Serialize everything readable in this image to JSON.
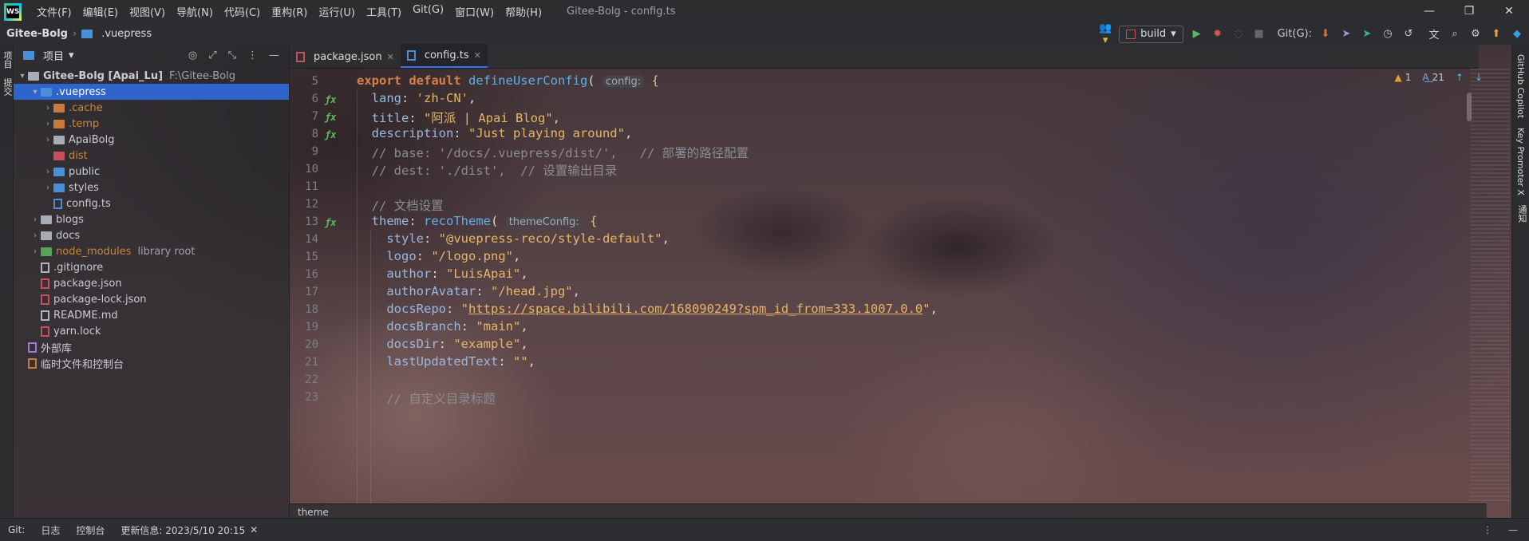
{
  "window": {
    "logo_text": "WS",
    "menu": [
      "文件(F)",
      "编辑(E)",
      "视图(V)",
      "导航(N)",
      "代码(C)",
      "重构(R)",
      "运行(U)",
      "工具(T)",
      "Git(G)",
      "窗口(W)",
      "帮助(H)"
    ],
    "title": "Gitee-Bolg - config.ts",
    "controls": [
      "—",
      "❐",
      "✕"
    ]
  },
  "nav": {
    "project": "Gitee-Bolg",
    "sep": "›",
    "folder": ".vuepress",
    "run_config": "build",
    "git_label": "Git(G):"
  },
  "left_strip": {
    "tabs": [
      "项目",
      "提交"
    ]
  },
  "project_panel": {
    "header": "项目",
    "tree": [
      {
        "label": "Gitee-Bolg [Apai_Lu]",
        "extra": "F:\\Gitee-Bolg",
        "depth": 0,
        "arrow": "▾",
        "icon": "folder",
        "color": "gray",
        "bold": true
      },
      {
        "label": ".vuepress",
        "depth": 1,
        "arrow": "▾",
        "icon": "folder",
        "color": "blue",
        "selected": true
      },
      {
        "label": ".cache",
        "depth": 2,
        "arrow": "›",
        "icon": "folder",
        "color": "orange",
        "dim": true
      },
      {
        "label": ".temp",
        "depth": 2,
        "arrow": "›",
        "icon": "folder",
        "color": "orange",
        "dim": true
      },
      {
        "label": "ApaiBolg",
        "depth": 2,
        "arrow": "›",
        "icon": "folder",
        "color": "gray"
      },
      {
        "label": "dist",
        "depth": 2,
        "arrow": "",
        "icon": "folder",
        "color": "red",
        "dim": true
      },
      {
        "label": "public",
        "depth": 2,
        "arrow": "›",
        "icon": "folder",
        "color": "blue"
      },
      {
        "label": "styles",
        "depth": 2,
        "arrow": "›",
        "icon": "folder",
        "color": "blue"
      },
      {
        "label": "config.ts",
        "depth": 2,
        "arrow": "",
        "icon": "ts",
        "color": "blue"
      },
      {
        "label": "blogs",
        "depth": 1,
        "arrow": "›",
        "icon": "folder",
        "color": "gray"
      },
      {
        "label": "docs",
        "depth": 1,
        "arrow": "›",
        "icon": "folder",
        "color": "gray"
      },
      {
        "label": "node_modules",
        "extra": "library root",
        "depth": 1,
        "arrow": "›",
        "icon": "folder",
        "color": "green",
        "dim": true
      },
      {
        "label": ".gitignore",
        "depth": 1,
        "arrow": "",
        "icon": "git",
        "color": "gray"
      },
      {
        "label": "package.json",
        "depth": 1,
        "arrow": "",
        "icon": "json",
        "color": "red"
      },
      {
        "label": "package-lock.json",
        "depth": 1,
        "arrow": "",
        "icon": "json",
        "color": "red"
      },
      {
        "label": "README.md",
        "depth": 1,
        "arrow": "",
        "icon": "md",
        "color": "gray"
      },
      {
        "label": "yarn.lock",
        "depth": 1,
        "arrow": "",
        "icon": "lock",
        "color": "red"
      },
      {
        "label": "外部库",
        "depth": 0,
        "arrow": "",
        "icon": "lib",
        "color": "purple"
      },
      {
        "label": "临时文件和控制台",
        "depth": 0,
        "arrow": "",
        "icon": "scratch",
        "color": "orange"
      }
    ]
  },
  "tabs": [
    {
      "label": "package.json",
      "close": "✕",
      "active": false
    },
    {
      "label": "config.ts",
      "close": "✕",
      "active": true
    }
  ],
  "inspections": {
    "warnings": "1",
    "typos": "21"
  },
  "editor": {
    "lines": [
      {
        "n": "5",
        "gi": false,
        "html": "<span class=\"kw\">export default </span><span class=\"fn\">defineUserConfig</span>( <span class=\"hint\">config:</span> <span style=\"color:#e6c07b\">{</span>"
      },
      {
        "n": "6",
        "gi": true,
        "html": "  <span class=\"prop\">lang</span>: <span class=\"str\">'zh-CN'</span>,"
      },
      {
        "n": "7",
        "gi": true,
        "html": "  <span class=\"prop\">title</span>: <span class=\"str\">\"阿派 | Apai Blog\"</span>,"
      },
      {
        "n": "8",
        "gi": true,
        "html": "  <span class=\"prop\">description</span>: <span class=\"str\">\"Just playing around\"</span>,"
      },
      {
        "n": "9",
        "gi": false,
        "html": "  <span class=\"cmt\">// base: '/docs/.vuepress/dist/',   // 部署的路径配置</span>"
      },
      {
        "n": "10",
        "gi": false,
        "html": "  <span class=\"cmt\">// dest: './dist',  // 设置输出目录</span>"
      },
      {
        "n": "11",
        "gi": false,
        "html": ""
      },
      {
        "n": "12",
        "gi": false,
        "html": "  <span class=\"cmt\">// 文档设置</span>"
      },
      {
        "n": "13",
        "gi": true,
        "html": "  <span class=\"prop\">theme</span>: <span class=\"fn\">recoTheme</span>( <span class=\"hint\">themeConfig:</span> <span style=\"color:#e6c07b\">{</span>"
      },
      {
        "n": "14",
        "gi": false,
        "html": "    <span class=\"prop\">style</span>: <span class=\"str\">\"@vuepress-reco/style-default\"</span>,"
      },
      {
        "n": "15",
        "gi": false,
        "html": "    <span class=\"prop\">logo</span>: <span class=\"str\">\"/logo.png\"</span>,"
      },
      {
        "n": "16",
        "gi": false,
        "html": "    <span class=\"prop\">author</span>: <span class=\"str\">\"LuisApai\"</span>,"
      },
      {
        "n": "17",
        "gi": false,
        "html": "    <span class=\"prop\">authorAvatar</span>: <span class=\"str\">\"/head.jpg\"</span>,"
      },
      {
        "n": "18",
        "gi": false,
        "html": "    <span class=\"prop\">docsRepo</span>: <span class=\"str\">\"<span class=\"link\">https://space.bilibili.com/168090249?spm_id_from=333.1007.0.0</span>\"</span>,"
      },
      {
        "n": "19",
        "gi": false,
        "html": "    <span class=\"prop\">docsBranch</span>: <span class=\"str\">\"main\"</span>,"
      },
      {
        "n": "20",
        "gi": false,
        "html": "    <span class=\"prop\">docsDir</span>: <span class=\"str\">\"example\"</span>,"
      },
      {
        "n": "21",
        "gi": false,
        "html": "    <span class=\"prop\">lastUpdatedText</span>: <span class=\"str\">\"\"</span>,"
      },
      {
        "n": "22",
        "gi": false,
        "html": ""
      },
      {
        "n": "23",
        "gi": false,
        "html": "    <span class=\"cmt\">// 自定义目录标题</span>"
      }
    ],
    "gutter_glyph": "ƒx"
  },
  "right_strip": {
    "tabs": [
      "GitHub Copilot",
      "Key Promoter X",
      "通知"
    ]
  },
  "breadcrumb_bar": {
    "text": "theme"
  },
  "status": {
    "git": "Git:",
    "log": "日志",
    "console": "控制台",
    "update": "更新信息: 2023/5/10 20:15",
    "close": "✕",
    "menu_icon": "⋮",
    "minimize_icon": "—"
  }
}
